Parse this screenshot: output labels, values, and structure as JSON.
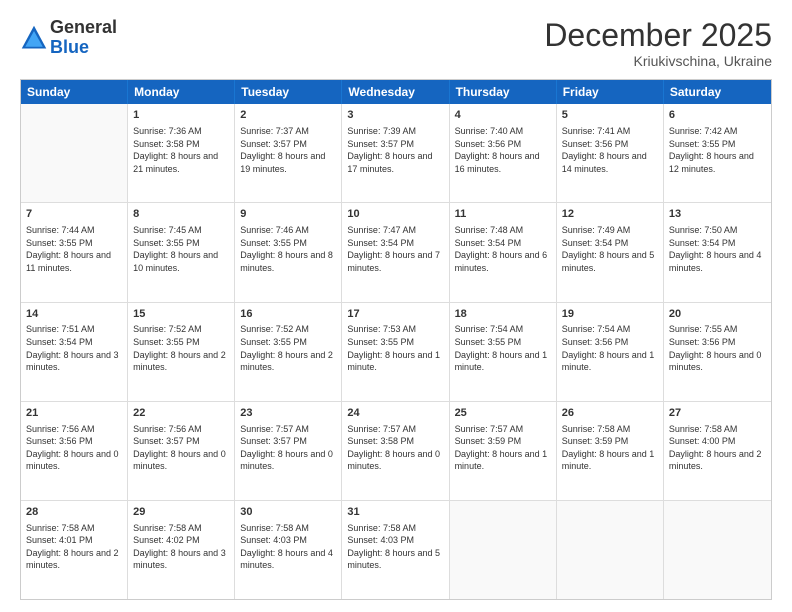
{
  "header": {
    "logo": {
      "line1": "General",
      "line2": "Blue"
    },
    "title": "December 2025",
    "location": "Kriukivschina, Ukraine"
  },
  "days_of_week": [
    "Sunday",
    "Monday",
    "Tuesday",
    "Wednesday",
    "Thursday",
    "Friday",
    "Saturday"
  ],
  "weeks": [
    [
      {
        "day": "",
        "empty": true
      },
      {
        "day": "1",
        "sunrise": "Sunrise: 7:36 AM",
        "sunset": "Sunset: 3:58 PM",
        "daylight": "Daylight: 8 hours and 21 minutes."
      },
      {
        "day": "2",
        "sunrise": "Sunrise: 7:37 AM",
        "sunset": "Sunset: 3:57 PM",
        "daylight": "Daylight: 8 hours and 19 minutes."
      },
      {
        "day": "3",
        "sunrise": "Sunrise: 7:39 AM",
        "sunset": "Sunset: 3:57 PM",
        "daylight": "Daylight: 8 hours and 17 minutes."
      },
      {
        "day": "4",
        "sunrise": "Sunrise: 7:40 AM",
        "sunset": "Sunset: 3:56 PM",
        "daylight": "Daylight: 8 hours and 16 minutes."
      },
      {
        "day": "5",
        "sunrise": "Sunrise: 7:41 AM",
        "sunset": "Sunset: 3:56 PM",
        "daylight": "Daylight: 8 hours and 14 minutes."
      },
      {
        "day": "6",
        "sunrise": "Sunrise: 7:42 AM",
        "sunset": "Sunset: 3:55 PM",
        "daylight": "Daylight: 8 hours and 12 minutes."
      }
    ],
    [
      {
        "day": "7",
        "sunrise": "Sunrise: 7:44 AM",
        "sunset": "Sunset: 3:55 PM",
        "daylight": "Daylight: 8 hours and 11 minutes."
      },
      {
        "day": "8",
        "sunrise": "Sunrise: 7:45 AM",
        "sunset": "Sunset: 3:55 PM",
        "daylight": "Daylight: 8 hours and 10 minutes."
      },
      {
        "day": "9",
        "sunrise": "Sunrise: 7:46 AM",
        "sunset": "Sunset: 3:55 PM",
        "daylight": "Daylight: 8 hours and 8 minutes."
      },
      {
        "day": "10",
        "sunrise": "Sunrise: 7:47 AM",
        "sunset": "Sunset: 3:54 PM",
        "daylight": "Daylight: 8 hours and 7 minutes."
      },
      {
        "day": "11",
        "sunrise": "Sunrise: 7:48 AM",
        "sunset": "Sunset: 3:54 PM",
        "daylight": "Daylight: 8 hours and 6 minutes."
      },
      {
        "day": "12",
        "sunrise": "Sunrise: 7:49 AM",
        "sunset": "Sunset: 3:54 PM",
        "daylight": "Daylight: 8 hours and 5 minutes."
      },
      {
        "day": "13",
        "sunrise": "Sunrise: 7:50 AM",
        "sunset": "Sunset: 3:54 PM",
        "daylight": "Daylight: 8 hours and 4 minutes."
      }
    ],
    [
      {
        "day": "14",
        "sunrise": "Sunrise: 7:51 AM",
        "sunset": "Sunset: 3:54 PM",
        "daylight": "Daylight: 8 hours and 3 minutes."
      },
      {
        "day": "15",
        "sunrise": "Sunrise: 7:52 AM",
        "sunset": "Sunset: 3:55 PM",
        "daylight": "Daylight: 8 hours and 2 minutes."
      },
      {
        "day": "16",
        "sunrise": "Sunrise: 7:52 AM",
        "sunset": "Sunset: 3:55 PM",
        "daylight": "Daylight: 8 hours and 2 minutes."
      },
      {
        "day": "17",
        "sunrise": "Sunrise: 7:53 AM",
        "sunset": "Sunset: 3:55 PM",
        "daylight": "Daylight: 8 hours and 1 minute."
      },
      {
        "day": "18",
        "sunrise": "Sunrise: 7:54 AM",
        "sunset": "Sunset: 3:55 PM",
        "daylight": "Daylight: 8 hours and 1 minute."
      },
      {
        "day": "19",
        "sunrise": "Sunrise: 7:54 AM",
        "sunset": "Sunset: 3:56 PM",
        "daylight": "Daylight: 8 hours and 1 minute."
      },
      {
        "day": "20",
        "sunrise": "Sunrise: 7:55 AM",
        "sunset": "Sunset: 3:56 PM",
        "daylight": "Daylight: 8 hours and 0 minutes."
      }
    ],
    [
      {
        "day": "21",
        "sunrise": "Sunrise: 7:56 AM",
        "sunset": "Sunset: 3:56 PM",
        "daylight": "Daylight: 8 hours and 0 minutes."
      },
      {
        "day": "22",
        "sunrise": "Sunrise: 7:56 AM",
        "sunset": "Sunset: 3:57 PM",
        "daylight": "Daylight: 8 hours and 0 minutes."
      },
      {
        "day": "23",
        "sunrise": "Sunrise: 7:57 AM",
        "sunset": "Sunset: 3:57 PM",
        "daylight": "Daylight: 8 hours and 0 minutes."
      },
      {
        "day": "24",
        "sunrise": "Sunrise: 7:57 AM",
        "sunset": "Sunset: 3:58 PM",
        "daylight": "Daylight: 8 hours and 0 minutes."
      },
      {
        "day": "25",
        "sunrise": "Sunrise: 7:57 AM",
        "sunset": "Sunset: 3:59 PM",
        "daylight": "Daylight: 8 hours and 1 minute."
      },
      {
        "day": "26",
        "sunrise": "Sunrise: 7:58 AM",
        "sunset": "Sunset: 3:59 PM",
        "daylight": "Daylight: 8 hours and 1 minute."
      },
      {
        "day": "27",
        "sunrise": "Sunrise: 7:58 AM",
        "sunset": "Sunset: 4:00 PM",
        "daylight": "Daylight: 8 hours and 2 minutes."
      }
    ],
    [
      {
        "day": "28",
        "sunrise": "Sunrise: 7:58 AM",
        "sunset": "Sunset: 4:01 PM",
        "daylight": "Daylight: 8 hours and 2 minutes."
      },
      {
        "day": "29",
        "sunrise": "Sunrise: 7:58 AM",
        "sunset": "Sunset: 4:02 PM",
        "daylight": "Daylight: 8 hours and 3 minutes."
      },
      {
        "day": "30",
        "sunrise": "Sunrise: 7:58 AM",
        "sunset": "Sunset: 4:03 PM",
        "daylight": "Daylight: 8 hours and 4 minutes."
      },
      {
        "day": "31",
        "sunrise": "Sunrise: 7:58 AM",
        "sunset": "Sunset: 4:03 PM",
        "daylight": "Daylight: 8 hours and 5 minutes."
      },
      {
        "day": "",
        "empty": true
      },
      {
        "day": "",
        "empty": true
      },
      {
        "day": "",
        "empty": true
      }
    ]
  ]
}
